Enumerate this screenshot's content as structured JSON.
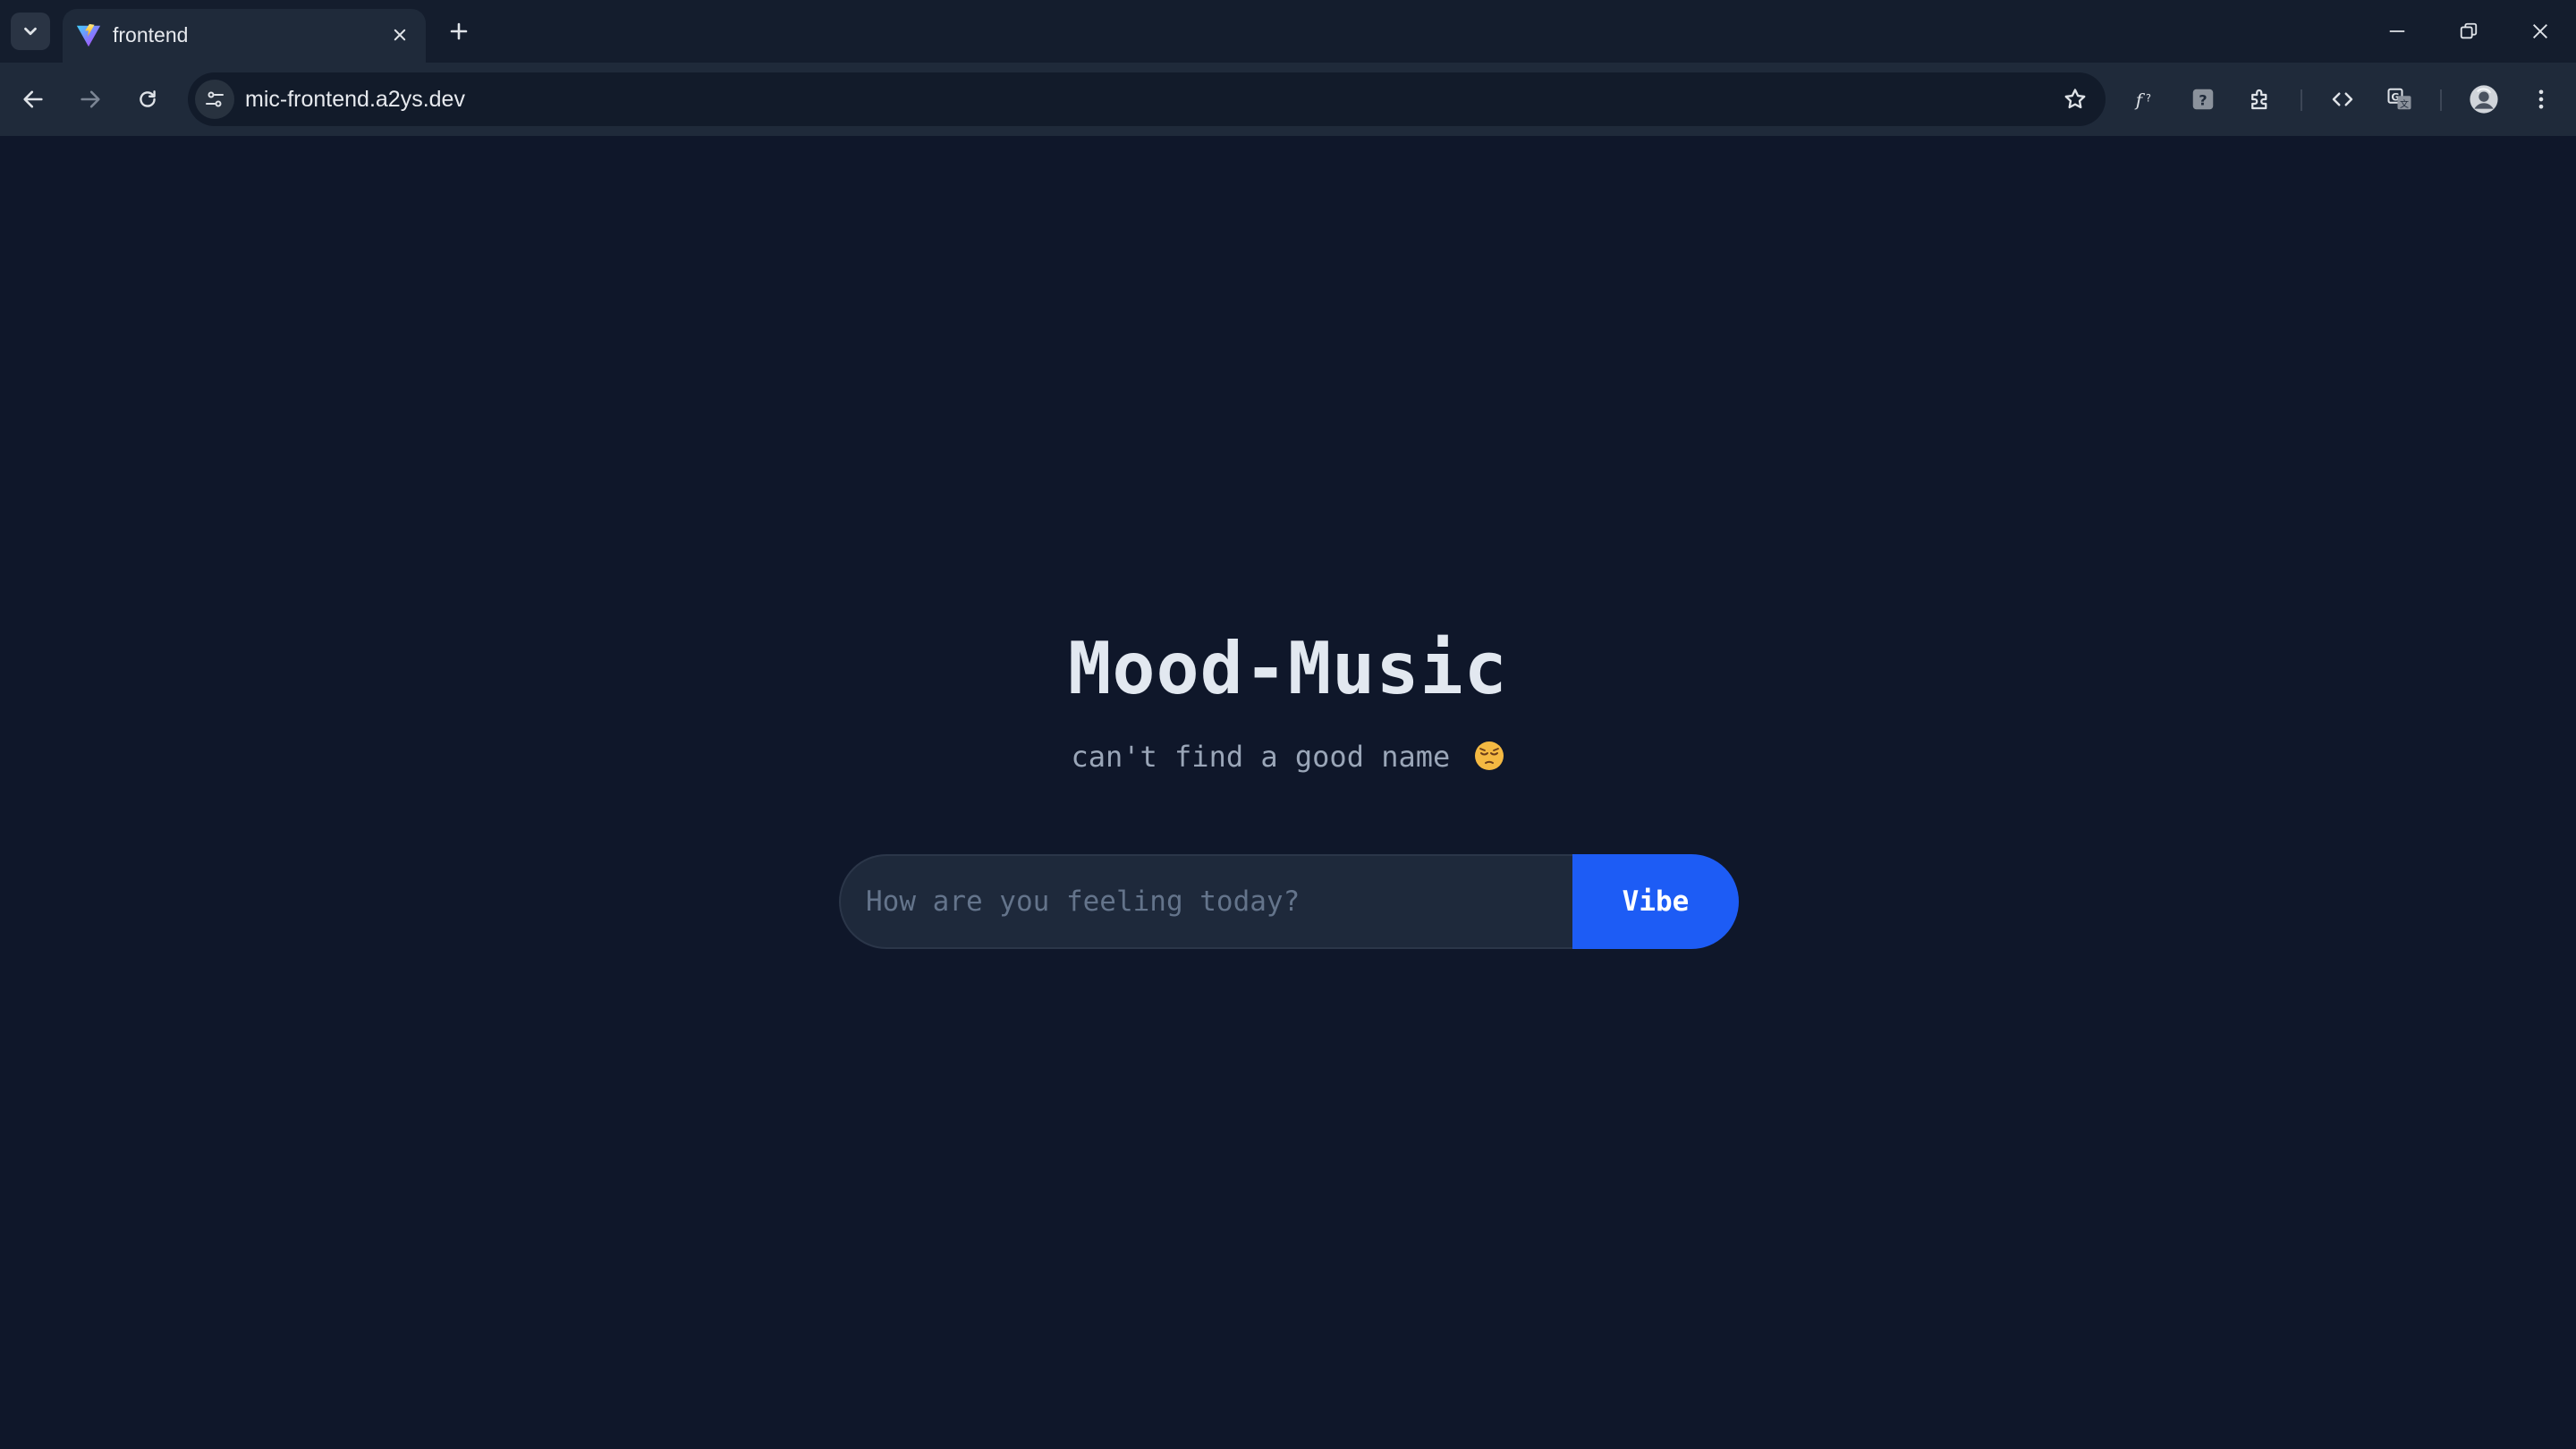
{
  "browser": {
    "tab": {
      "title": "frontend",
      "favicon": "vite-logo-icon"
    },
    "address_bar": {
      "url": "mic-frontend.a2ys.dev"
    },
    "icons": {
      "tab_search": "chevron-down-icon",
      "tab_close": "close-icon",
      "new_tab": "plus-icon",
      "back": "arrow-left-icon",
      "forward": "arrow-right-icon",
      "reload": "reload-icon",
      "site_info": "tune-icon",
      "bookmark": "star-icon",
      "extensions": [
        "function-extension-icon",
        "help-extension-icon",
        "puzzle-icon",
        "code-icon",
        "translate-icon"
      ],
      "profile": "avatar",
      "menu": "kebab-menu-icon",
      "window_controls": [
        "minimize-icon",
        "restore-icon",
        "close-window-icon"
      ]
    }
  },
  "app": {
    "title": "Mood-Music",
    "subtitle": "can't find a good name",
    "subtitle_emoji": "pensive-face-emoji",
    "input": {
      "placeholder": "How are you feeling today?",
      "value": ""
    },
    "submit_label": "Vibe"
  },
  "colors": {
    "page_background": "#0f172a",
    "title_text": "#e2e8f0",
    "subtitle_text": "#9aa6b8",
    "input_background": "#1e293b",
    "accent_button": "#1d5cf5",
    "chrome_tabstrip": "#141d2d",
    "chrome_toolbar": "#1f2a3a"
  }
}
